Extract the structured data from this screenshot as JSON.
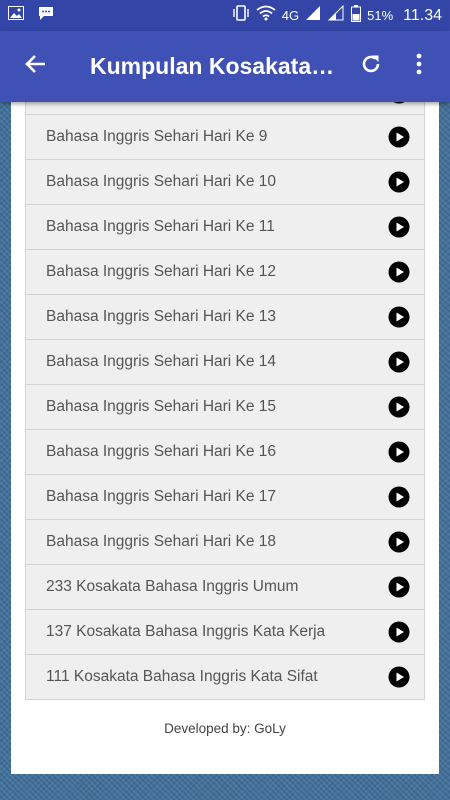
{
  "status_bar": {
    "network": "4G",
    "battery": "51%",
    "time": "11.34"
  },
  "app_bar": {
    "title": "Kumpulan Kosakata…"
  },
  "list": {
    "items": [
      {
        "label": ""
      },
      {
        "label": "Bahasa Inggris Sehari Hari Ke 9"
      },
      {
        "label": "Bahasa Inggris Sehari Hari Ke 10"
      },
      {
        "label": "Bahasa Inggris Sehari Hari Ke 11"
      },
      {
        "label": "Bahasa Inggris Sehari Hari Ke 12"
      },
      {
        "label": "Bahasa Inggris Sehari Hari Ke 13"
      },
      {
        "label": "Bahasa Inggris Sehari Hari Ke 14"
      },
      {
        "label": "Bahasa Inggris Sehari Hari Ke 15"
      },
      {
        "label": "Bahasa Inggris Sehari Hari Ke 16"
      },
      {
        "label": "Bahasa Inggris Sehari Hari Ke 17"
      },
      {
        "label": "Bahasa Inggris Sehari Hari Ke 18"
      },
      {
        "label": "233 Kosakata Bahasa Inggris Umum"
      },
      {
        "label": "137 Kosakata Bahasa Inggris Kata Kerja"
      },
      {
        "label": "111 Kosakata Bahasa Inggris Kata Sifat"
      }
    ]
  },
  "footer": {
    "text": "Developed by: GoLy"
  },
  "colors": {
    "app_bar": "#3f51b5",
    "status_bar": "#3346a8",
    "item_bg": "#efefef"
  }
}
